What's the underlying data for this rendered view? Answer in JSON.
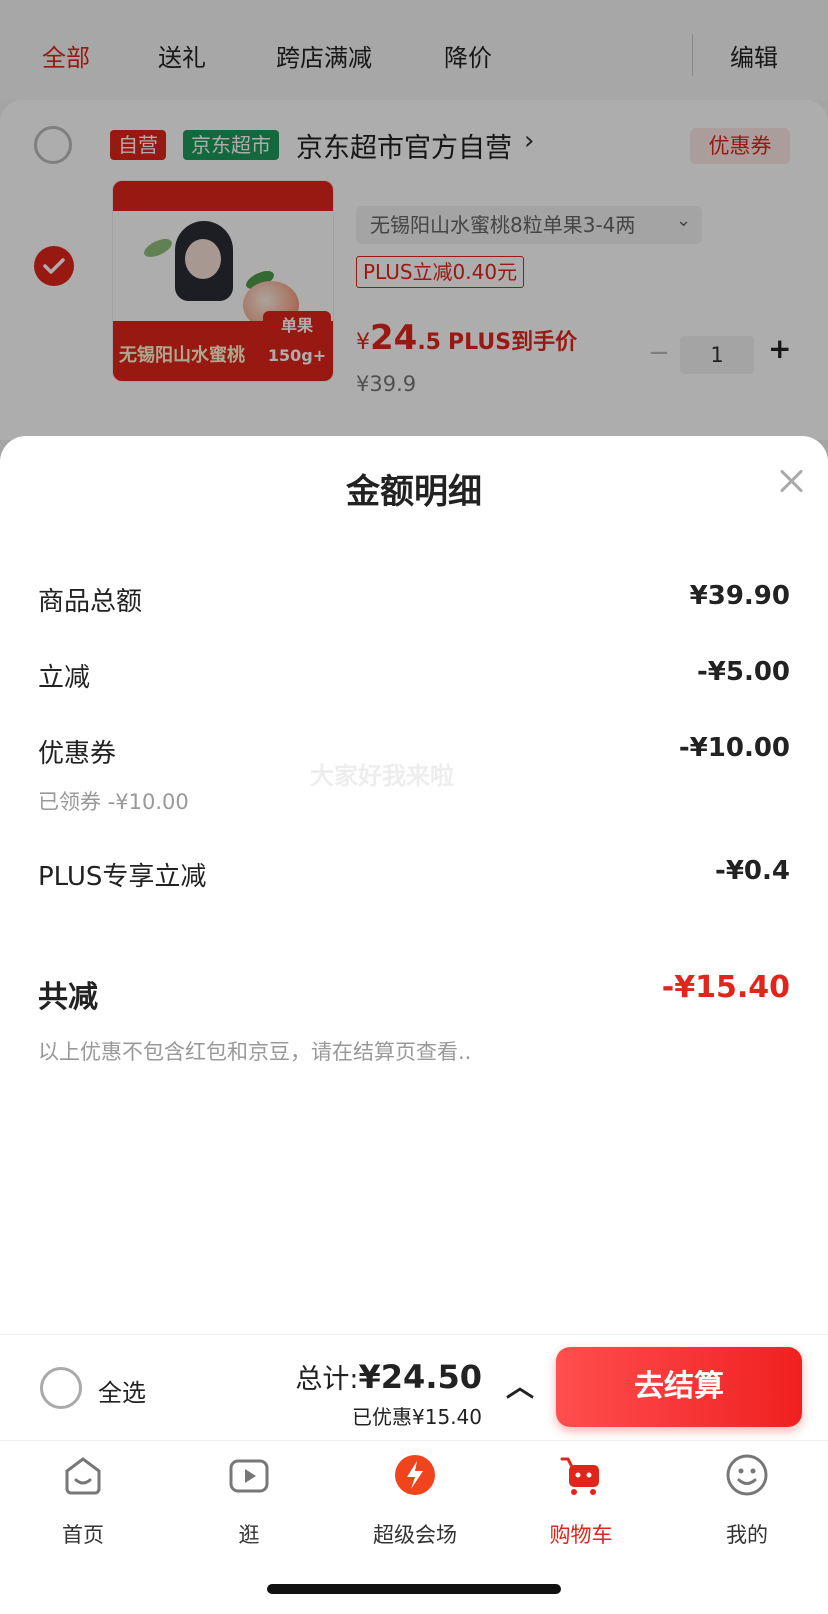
{
  "filter_tabs": [
    "全部",
    "送礼",
    "跨店满减",
    "降价"
  ],
  "edit_label": "编辑",
  "shop": {
    "tag_self": "自营",
    "tag_jd": "京东超市",
    "name": "京东超市官方自营",
    "coupon_label": "优惠券"
  },
  "product": {
    "image_label": "无锡阳山水蜜桃",
    "image_badge": "单果 150g+",
    "spec": "无锡阳山水蜜桃8粒单果3-4两",
    "plus_tag": "PLUS立减0.40元",
    "price_symbol": "¥",
    "price_int": "24",
    "price_dec": ".5",
    "price_suffix": "PLUS到手价",
    "original_price": "¥39.9",
    "quantity": "1"
  },
  "sheet": {
    "title": "金额明细",
    "watermark": "大家好我来啦",
    "rows": [
      {
        "label": "商品总额",
        "value": "¥39.90"
      },
      {
        "label": "立减",
        "value": "-¥5.00"
      },
      {
        "label": "优惠券",
        "value": "-¥10.00",
        "sub": "已领券 -¥10.00"
      },
      {
        "label": "PLUS专享立减",
        "value": "-¥0.4"
      }
    ],
    "total_label": "共减",
    "total_value": "-¥15.40",
    "note": "以上优惠不包含红包和京豆，请在结算页查看.."
  },
  "checkout": {
    "select_all": "全选",
    "total_prefix": "总计:",
    "total_amount": "¥24.50",
    "saved": "已优惠¥15.40",
    "button": "去结算"
  },
  "tabbar": [
    {
      "label": "首页",
      "icon": "home-icon"
    },
    {
      "label": "逛",
      "icon": "play-icon"
    },
    {
      "label": "超级会场",
      "icon": "super-venue-icon"
    },
    {
      "label": "购物车",
      "icon": "cart-icon",
      "active": true
    },
    {
      "label": "我的",
      "icon": "profile-icon"
    }
  ],
  "colors": {
    "accent": "#e1251b",
    "jd_green": "#1e9a5a"
  }
}
